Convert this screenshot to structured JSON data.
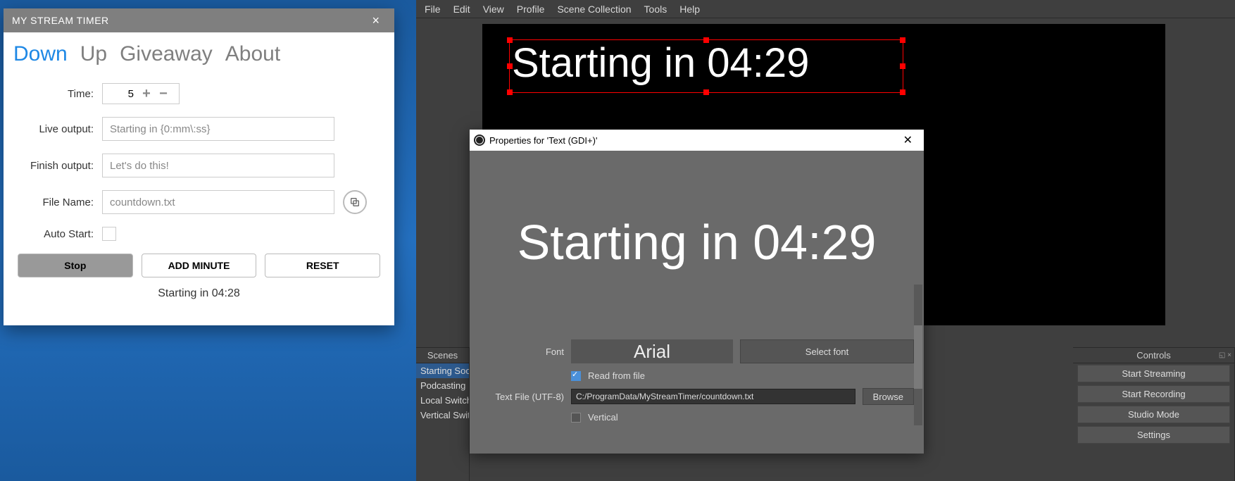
{
  "mst": {
    "title": "MY STREAM TIMER",
    "tabs": {
      "down": "Down",
      "up": "Up",
      "giveaway": "Giveaway",
      "about": "About"
    },
    "labels": {
      "time": "Time:",
      "live": "Live output:",
      "finish": "Finish output:",
      "file": "File Name:",
      "auto": "Auto Start:"
    },
    "values": {
      "time": "5",
      "live": "Starting in {0:mm\\:ss}",
      "finish": "Let's do this!",
      "file": "countdown.txt"
    },
    "buttons": {
      "stop": "Stop",
      "addmin": "ADD MINUTE",
      "reset": "RESET"
    },
    "status": "Starting in 04:28"
  },
  "obs": {
    "menu": [
      "File",
      "Edit",
      "View",
      "Profile",
      "Scene Collection",
      "Tools",
      "Help"
    ],
    "preview_text": "Starting in 04:29",
    "scenes_header": "Scenes",
    "scenes": [
      "Starting Soo",
      "Podcasting",
      "Local Switch",
      "Vertical Swit"
    ],
    "controls_header": "Controls",
    "controls": [
      "Start Streaming",
      "Start Recording",
      "Studio Mode",
      "Settings"
    ]
  },
  "props": {
    "title": "Properties for 'Text (GDI+)'",
    "preview_text": "Starting in 04:29",
    "labels": {
      "font": "Font",
      "readfile": "Read from file",
      "textfile": "Text File (UTF-8)",
      "vertical": "Vertical"
    },
    "font_name": "Arial",
    "select_font": "Select font",
    "file_path": "C:/ProgramData/MyStreamTimer/countdown.txt",
    "browse": "Browse"
  }
}
